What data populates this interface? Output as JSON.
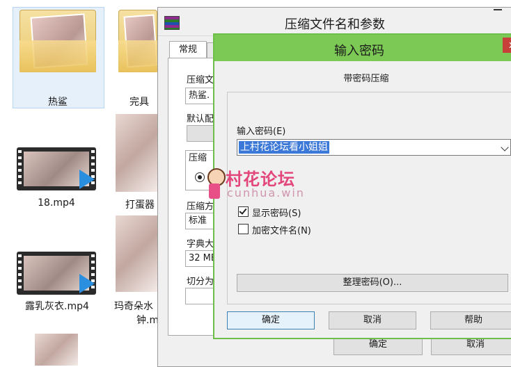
{
  "explorer": {
    "items": [
      {
        "label": "热鲨"
      },
      {
        "label": "完具"
      },
      {
        "label": "18.mp4"
      },
      {
        "label": "打蛋器"
      },
      {
        "label": "露乳灰衣.mp4"
      },
      {
        "label": "玛奇朵水"
      },
      {
        "label": "钟.m"
      }
    ]
  },
  "background_dialog": {
    "title": "压缩文件名和参数",
    "tab_general": "常规",
    "archive_name_label": "压缩文",
    "archive_name_value": "热鲨.",
    "default_config_label": "默认配",
    "compress_format_label": "压缩",
    "compress_method_label": "压缩方",
    "compress_method_value": "标准",
    "dictionary_label": "字典大",
    "dictionary_value": "32 MB",
    "split_label": "切分为",
    "ok": "确定",
    "cancel": "取消"
  },
  "password_dialog": {
    "title": "输入密码",
    "close": "x",
    "subtitle": "带密码压缩",
    "enter_password_label": "输入密码(E)",
    "password_value": "上村花论坛看小姐姐",
    "show_password_label": "显示密码(S)",
    "show_password_checked": true,
    "encrypt_names_label": "加密文件名(N)",
    "encrypt_names_checked": false,
    "organize_button": "整理密码(O)...",
    "ok_button": "确定",
    "cancel_button": "取消",
    "help_button": "帮助"
  },
  "watermark": {
    "cn": "村花论坛",
    "en": "cunhua.win"
  }
}
